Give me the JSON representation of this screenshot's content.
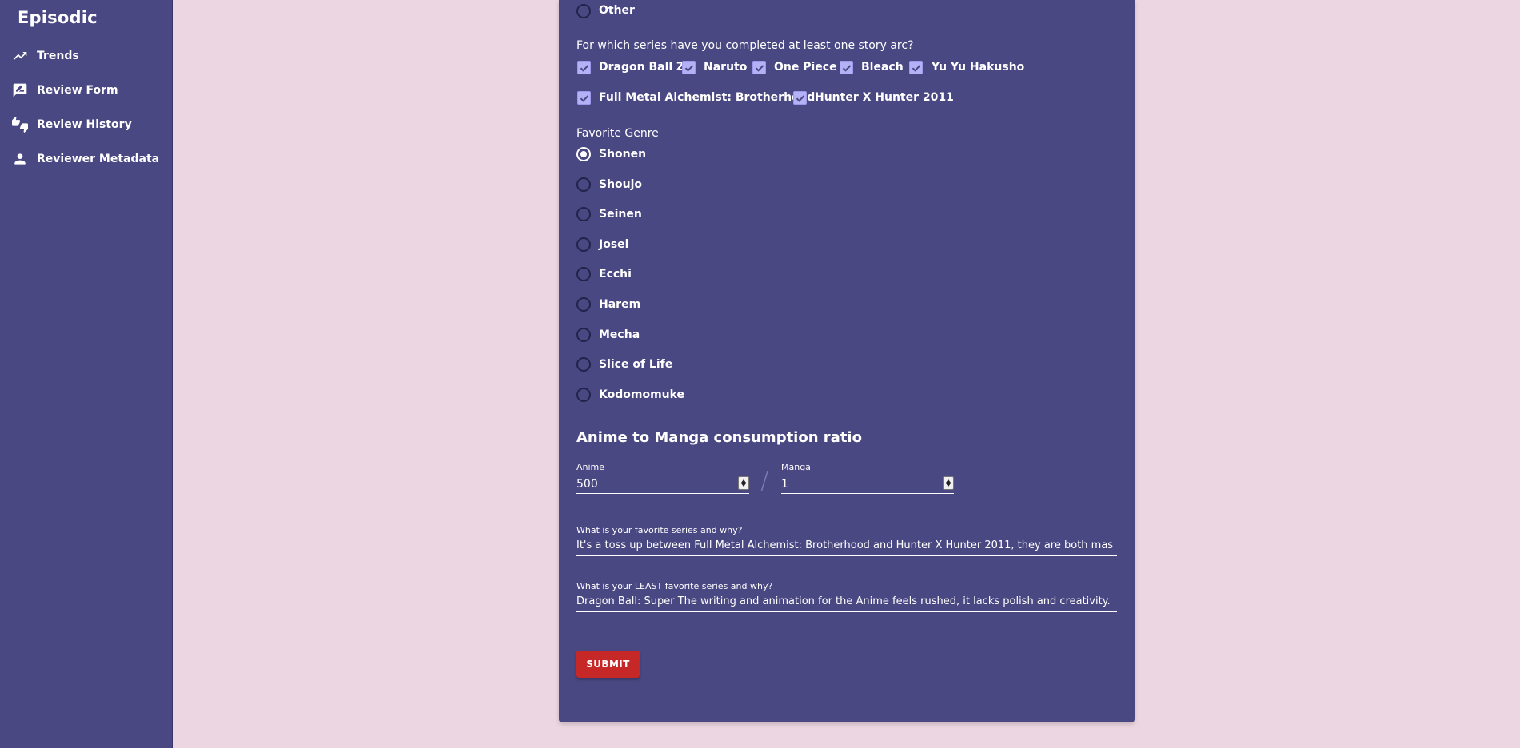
{
  "app": {
    "title": "Episodic"
  },
  "sidebar": {
    "items": [
      {
        "label": "Trends",
        "icon": "trending-up-icon"
      },
      {
        "label": "Review Form",
        "icon": "rate-review-icon"
      },
      {
        "label": "Review History",
        "icon": "thumbs-up-down-icon"
      },
      {
        "label": "Reviewer Metadata",
        "icon": "person-icon"
      }
    ]
  },
  "form": {
    "prev_option": {
      "label": "Other",
      "checked": false
    },
    "arc_question": "For which series have you completed at least one story arc?",
    "arc_series": [
      {
        "label": "Dragon Ball Z",
        "checked": true
      },
      {
        "label": "Naruto",
        "checked": true
      },
      {
        "label": "One Piece",
        "checked": true
      },
      {
        "label": "Bleach",
        "checked": true
      },
      {
        "label": "Yu Yu Hakusho",
        "checked": true
      },
      {
        "label": "Full Metal Alchemist: Brotherhood",
        "checked": true
      },
      {
        "label": "Hunter X Hunter 2011",
        "checked": true
      }
    ],
    "genre_question": "Favorite Genre",
    "genres": [
      {
        "label": "Shonen",
        "checked": true
      },
      {
        "label": "Shoujo",
        "checked": false
      },
      {
        "label": "Seinen",
        "checked": false
      },
      {
        "label": "Josei",
        "checked": false
      },
      {
        "label": "Ecchi",
        "checked": false
      },
      {
        "label": "Harem",
        "checked": false
      },
      {
        "label": "Mecha",
        "checked": false
      },
      {
        "label": "Slice of Life",
        "checked": false
      },
      {
        "label": "Kodomomuke",
        "checked": false
      }
    ],
    "ratio": {
      "title": "Anime to Manga consumption ratio",
      "anime_label": "Anime",
      "anime_value": "500",
      "separator": "/",
      "manga_label": "Manga",
      "manga_value": "1"
    },
    "favorite": {
      "label": "What is your favorite series and why?",
      "value": "It's a toss up between Full Metal Alchemist: Brotherhood and Hunter X Hunter 2011, they are both mas"
    },
    "least_favorite": {
      "label": "What is your LEAST favorite series and why?",
      "value": "Dragon Ball: Super The writing and animation for the Anime feels rushed, it lacks polish and creativity."
    },
    "submit_label": "SUBMIT"
  },
  "colors": {
    "page_background": "#ecd6e1",
    "panel": "#4a4882",
    "checkbox": "#b4b1f6",
    "submit": "#c62828"
  }
}
